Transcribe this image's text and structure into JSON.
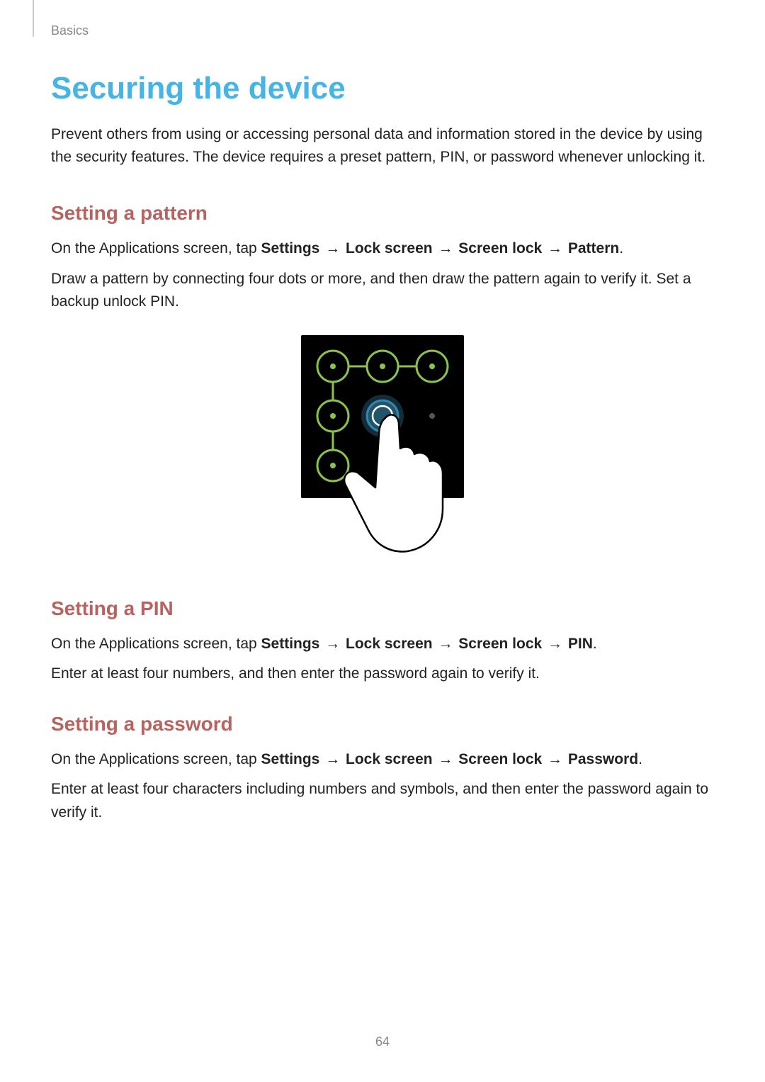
{
  "header": {
    "section_label": "Basics"
  },
  "page": {
    "title": "Securing the device",
    "intro": "Prevent others from using or accessing personal data and information stored in the device by using the security features. The device requires a preset pattern, PIN, or password whenever unlocking it.",
    "number": "64"
  },
  "nav_path": {
    "prefix": "On the Applications screen, tap ",
    "arrow": " → ",
    "step1": "Settings",
    "step2": "Lock screen",
    "step3": "Screen lock",
    "pattern": "Pattern",
    "pin": "PIN",
    "password": "Password",
    "period": "."
  },
  "sections": {
    "pattern": {
      "heading": "Setting a pattern",
      "body": "Draw a pattern by connecting four dots or more, and then draw the pattern again to verify it. Set a backup unlock PIN."
    },
    "pin": {
      "heading": "Setting a PIN",
      "body": "Enter at least four numbers, and then enter the password again to verify it."
    },
    "password": {
      "heading": "Setting a password",
      "body": "Enter at least four characters including numbers and symbols, and then enter the password again to verify it."
    }
  }
}
